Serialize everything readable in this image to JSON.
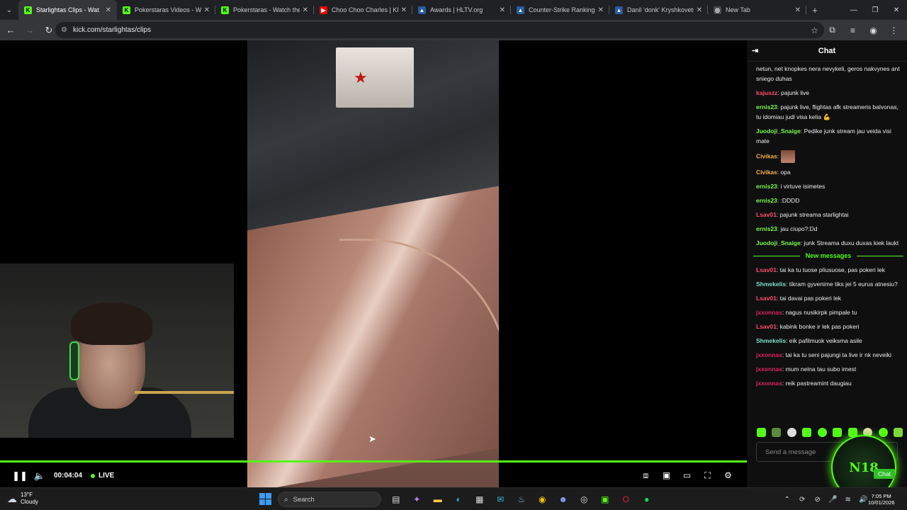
{
  "browser": {
    "tabs": [
      {
        "title": "Starlightas Clips - Wat",
        "favicon": "kick",
        "active": true
      },
      {
        "title": "Pokerstaras Videos - Wat",
        "favicon": "kick"
      },
      {
        "title": "Pokerstaras - Watch the V",
        "favicon": "kick"
      },
      {
        "title": "Choo Choo Charles | KILL",
        "favicon": "youtube"
      },
      {
        "title": "Awards | HLTV.org",
        "favicon": "hltv"
      },
      {
        "title": "Counter-Strike Ranking |",
        "favicon": "hltv"
      },
      {
        "title": "Danil 'donk' Kryshkovets",
        "favicon": "hltv"
      },
      {
        "title": "New Tab",
        "favicon": "chrome"
      }
    ],
    "url": "kick.com/starlightas/clips"
  },
  "player": {
    "timecode": "00:04:04",
    "live_label": "LIVE",
    "progress": 1.0,
    "accent": "#53fc18"
  },
  "chat": {
    "title": "Chat",
    "messages": [
      {
        "user": "",
        "color": "#ffffff",
        "text": "netun, net knopkes nera nevykeli, geros nakvynes ant sniego duhas"
      },
      {
        "user": "kajuszz",
        "color": "#ff4d6d",
        "text": "pajunk live"
      },
      {
        "user": "ernis23",
        "color": "#7cfc4a",
        "text": "pajunk live, flightas afk streameris balvonas, tu idomiau judi visa kelia 💪"
      },
      {
        "user": "Juodoji_Snaige",
        "color": "#7cfc4a",
        "text": "Pedike junk stream jau veida visi mate"
      },
      {
        "user": "Civikas",
        "color": "#f5b342",
        "text": "",
        "emote": true
      },
      {
        "user": "Civikas",
        "color": "#f5b342",
        "text": "opa"
      },
      {
        "user": "ernis23",
        "color": "#7cfc4a",
        "text": "i virtuve isimetes"
      },
      {
        "user": "ernis23",
        "color": "#7cfc4a",
        "text": ":DDDD"
      },
      {
        "user": "Lsav01",
        "color": "#ff4d6d",
        "text": "pajunk streama starlightai"
      },
      {
        "user": "ernis23",
        "color": "#7cfc4a",
        "text": "jau ciupo?:Dd"
      },
      {
        "user": "Juodoji_Snaige",
        "color": "#7cfc4a",
        "text": "junk Streama duxu duxas kiek laukt"
      }
    ],
    "new_messages_label": "New messages",
    "new_messages": [
      {
        "user": "Lsav01",
        "color": "#ff4d6d",
        "text": "tai ka tu tuose pliusuose, pas pokeri lek"
      },
      {
        "user": "Shmekelis",
        "color": "#7ee0c8",
        "text": "tikram gyvenime tiks jei 5 eurus atnesiu?"
      },
      {
        "user": "Lsav01",
        "color": "#ff4d6d",
        "text": "tai davai pas pokeri lek"
      },
      {
        "user": "jxxonnas",
        "color": "#e0245e",
        "text": "nagus nusikirpk pimpale tu"
      },
      {
        "user": "Lsav01",
        "color": "#ff4d6d",
        "text": "kabink bonke ir lek pas pokeri"
      },
      {
        "user": "Shmekelis",
        "color": "#7ee0c8",
        "text": "eik pafilmuok veiksma asile"
      },
      {
        "user": "jxxonnas",
        "color": "#e0245e",
        "text": "tai ka tu seni pajungi ta live ir nk neveiki"
      },
      {
        "user": "jxxonnas",
        "color": "#e0245e",
        "text": "mum neina tau subo imest"
      },
      {
        "user": "jxxonnas",
        "color": "#e0245e",
        "text": "reik pastreamint daugiau"
      }
    ],
    "input_placeholder": "Send a message",
    "overlay_text": "N18",
    "overlay_chat_label": "Chat"
  },
  "taskbar": {
    "weather_temp": "13°F",
    "weather_desc": "Cloudy",
    "search_label": "Search",
    "time": "7:05 PM",
    "date": "10/01/2026"
  }
}
